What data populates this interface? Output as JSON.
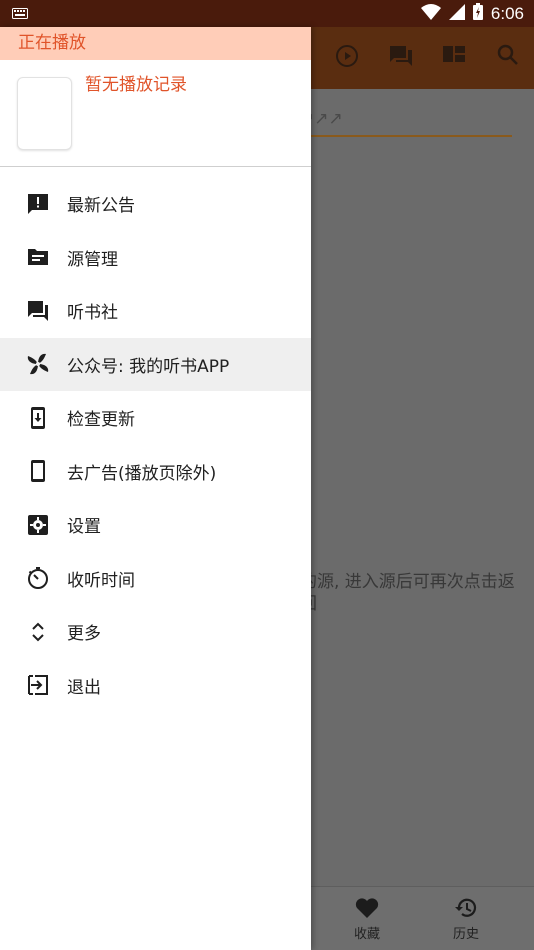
{
  "status_bar": {
    "time": "6:06"
  },
  "background": {
    "search_hint": "↗↗↗",
    "hint_text": "的源, 进入源后可再次点击返回",
    "bottom_nav": [
      {
        "label": "收藏",
        "icon": "heart-icon"
      },
      {
        "label": "历史",
        "icon": "history-icon"
      }
    ]
  },
  "drawer": {
    "now_playing_header": "正在播放",
    "now_playing_title": "暂无播放记录",
    "menu": [
      {
        "label": "最新公告",
        "icon": "announcement-icon"
      },
      {
        "label": "源管理",
        "icon": "folder-icon"
      },
      {
        "label": "听书社",
        "icon": "forum-icon"
      },
      {
        "label": "公众号: 我的听书APP",
        "icon": "pinwheel-icon",
        "active": true
      },
      {
        "label": "检查更新",
        "icon": "system-update-icon"
      },
      {
        "label": "去广告(播放页除外)",
        "icon": "phone-icon"
      },
      {
        "label": "设置",
        "icon": "settings-icon"
      },
      {
        "label": "收听时间",
        "icon": "timer-icon"
      },
      {
        "label": "更多",
        "icon": "unfold-more-icon"
      },
      {
        "label": "退出",
        "icon": "exit-icon"
      }
    ]
  },
  "colors": {
    "accent": "#e0542a",
    "now_playing_bg": "#ffcdb8",
    "status_bar": "#4a1b0c"
  }
}
